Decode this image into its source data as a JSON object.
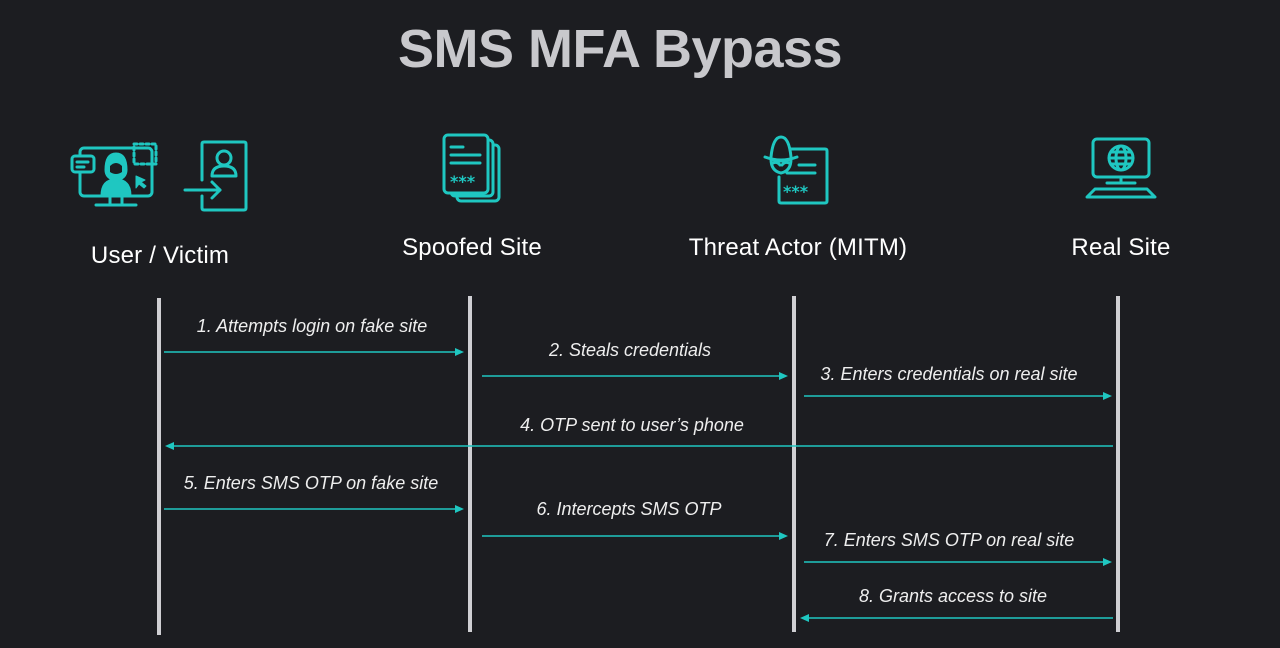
{
  "title": "SMS MFA Bypass",
  "colors": {
    "background": "#1c1d21",
    "accent": "#1fc7c1",
    "lifeline": "#cfcfd3",
    "title": "#c8c8cc",
    "text": "#ffffff"
  },
  "actors": [
    {
      "id": "user",
      "label": "User / Victim",
      "icons": [
        "user-at-computer-icon",
        "login-door-icon"
      ]
    },
    {
      "id": "spoofed",
      "label": "Spoofed Site",
      "icons": [
        "stacked-documents-password-icon"
      ]
    },
    {
      "id": "attacker",
      "label": "Threat Actor (MITM)",
      "icons": [
        "hacker-document-password-icon"
      ]
    },
    {
      "id": "real",
      "label": "Real Site",
      "icons": [
        "computer-globe-icon"
      ]
    }
  ],
  "messages": [
    {
      "step": 1,
      "label": "1. Attempts login on fake site",
      "from": "user",
      "to": "spoofed"
    },
    {
      "step": 2,
      "label": "2. Steals credentials",
      "from": "spoofed",
      "to": "attacker"
    },
    {
      "step": 3,
      "label": "3. Enters credentials on real site",
      "from": "attacker",
      "to": "real"
    },
    {
      "step": 4,
      "label": "4. OTP sent to user’s phone",
      "from": "real",
      "to": "user"
    },
    {
      "step": 5,
      "label": "5. Enters SMS OTP on fake site",
      "from": "user",
      "to": "spoofed"
    },
    {
      "step": 6,
      "label": "6. Intercepts SMS OTP",
      "from": "spoofed",
      "to": "attacker"
    },
    {
      "step": 7,
      "label": "7. Enters SMS OTP on real site",
      "from": "attacker",
      "to": "real"
    },
    {
      "step": 8,
      "label": "8. Grants access to site",
      "from": "real",
      "to": "attacker"
    }
  ]
}
